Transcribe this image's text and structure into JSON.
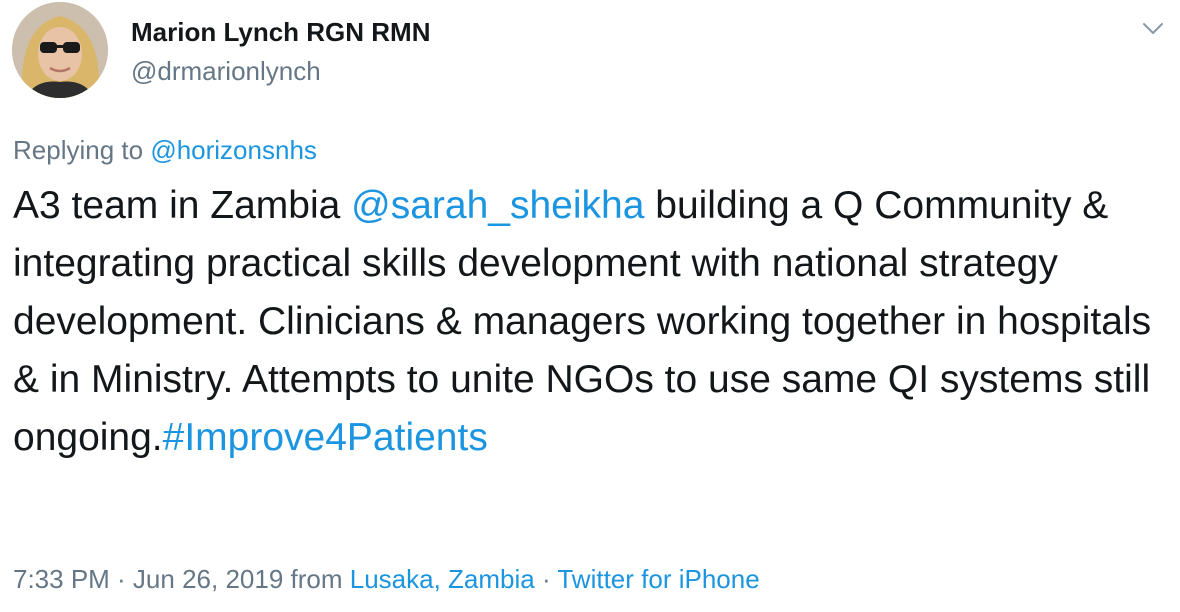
{
  "author": {
    "display_name": "Marion Lynch RGN RMN",
    "handle": "@drmarionlynch"
  },
  "reply": {
    "prefix": "Replying to ",
    "target": "@horizonsnhs"
  },
  "tweet": {
    "text_1": "A3 team in Zambia ",
    "mention": "@sarah_sheikha",
    "text_2": " building a Q Community & integrating practical skills development with national strategy development. Clinicians & managers working together in hospitals & in Ministry. Attempts to unite NGOs to use same QI systems still ongoing.",
    "hashtag": "#Improve4Patients"
  },
  "meta": {
    "time_date": "7:33 PM · Jun 26, 2019 from ",
    "location": "Lusaka, Zambia",
    "separator": " · ",
    "source": "Twitter for iPhone"
  },
  "colors": {
    "link": "#1b95e0",
    "secondary_text": "#657786",
    "primary_text": "#14171a"
  },
  "icons": {
    "caret": "chevron-down-icon",
    "avatar": "avatar"
  }
}
